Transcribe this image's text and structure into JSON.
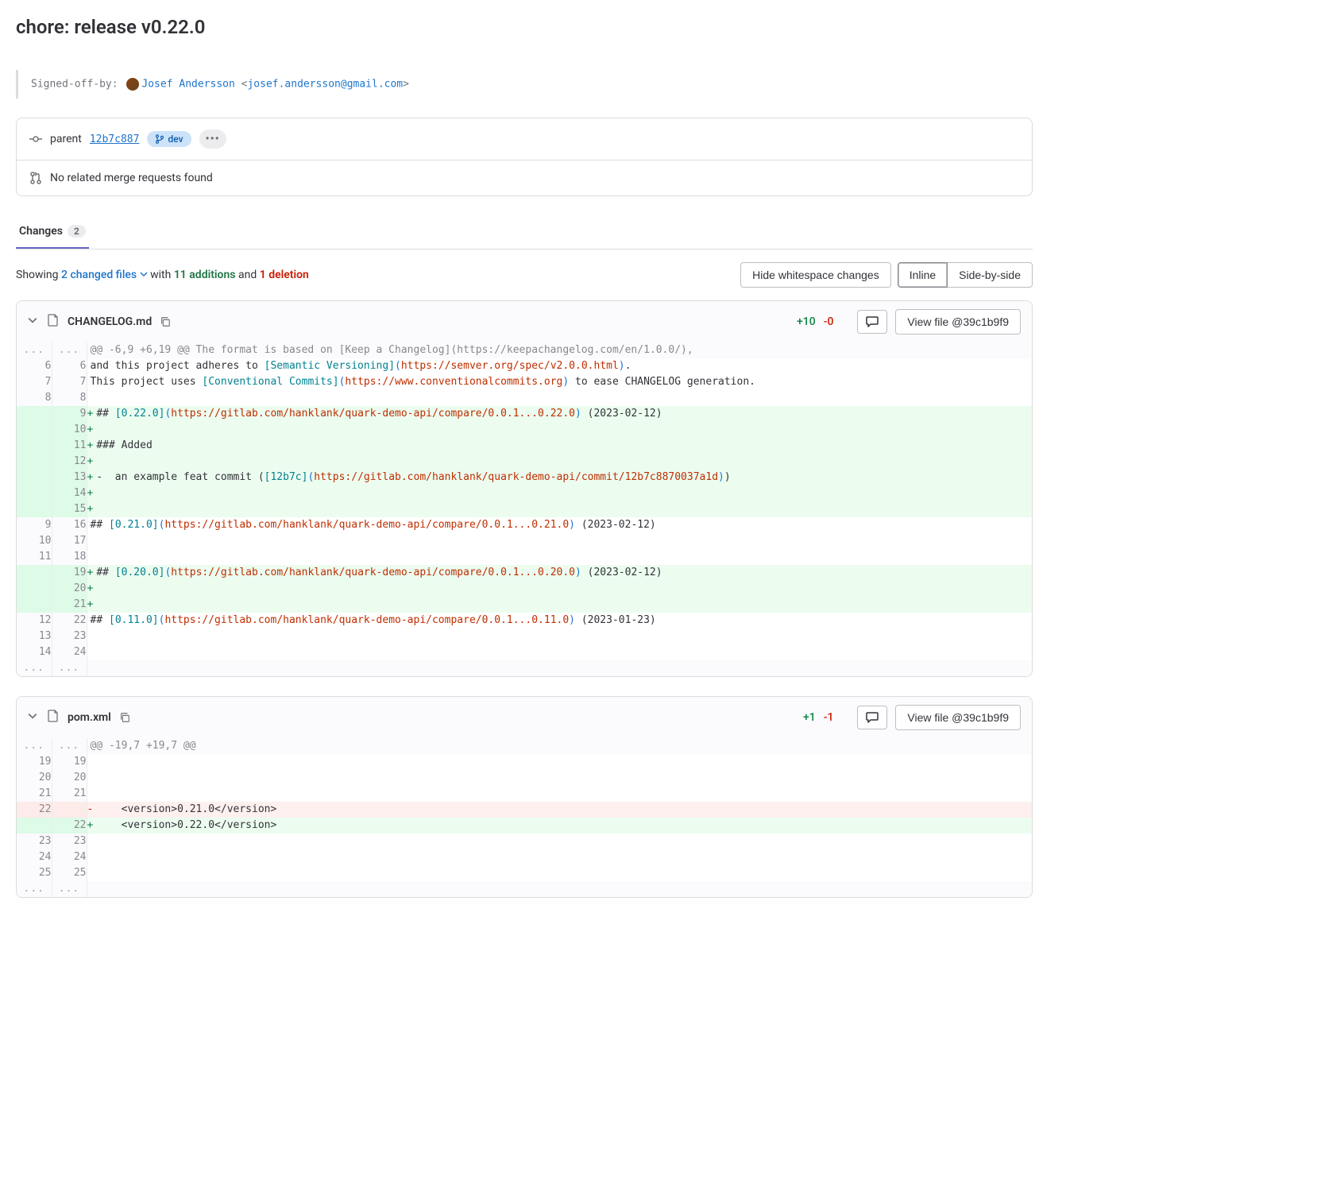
{
  "commit": {
    "title": "chore: release v0.22.0",
    "signed_off_label": "Signed-off-by:",
    "author_name": "Josef Andersson",
    "author_email": "josef.andersson@gmail.com",
    "parent_label": "parent",
    "parent_sha": "12b7c887",
    "branch_badge": "dev",
    "mr_text": "No related merge requests found"
  },
  "tabs": {
    "changes": "Changes",
    "changes_count": "2"
  },
  "summary": {
    "showing": "Showing",
    "files_text": "2 changed files",
    "with": "with",
    "additions": "11 additions",
    "and": "and",
    "deletions": "1 deletion"
  },
  "controls": {
    "hide_ws": "Hide whitespace changes",
    "inline": "Inline",
    "side": "Side-by-side"
  },
  "files": [
    {
      "name": "CHANGELOG.md",
      "stat_add": "+10",
      "stat_del": "-0",
      "view_label": "View file @39c1b9f9",
      "rows": [
        {
          "t": "hunk",
          "l": "...",
          "r": "...",
          "c": "@@ -6,9 +6,19 @@ The format is based on [Keep a Changelog](https://keepachangelog.com/en/1.0.0/),"
        },
        {
          "t": "ctx",
          "l": "6",
          "r": "6",
          "c": "and this project adheres to [Semantic Versioning](https://semver.org/spec/v2.0.0.html)."
        },
        {
          "t": "ctx",
          "l": "7",
          "r": "7",
          "c": "This project uses [Conventional Commits](https://www.conventionalcommits.org) to ease CHANGELOG generation."
        },
        {
          "t": "ctx",
          "l": "8",
          "r": "8",
          "c": ""
        },
        {
          "t": "add",
          "l": "",
          "r": "9",
          "c": "## [0.22.0](https://gitlab.com/hanklank/quark-demo-api/compare/0.0.1...0.22.0) (2023-02-12)"
        },
        {
          "t": "add",
          "l": "",
          "r": "10",
          "c": ""
        },
        {
          "t": "add",
          "l": "",
          "r": "11",
          "c": "### Added"
        },
        {
          "t": "add",
          "l": "",
          "r": "12",
          "c": ""
        },
        {
          "t": "add",
          "l": "",
          "r": "13",
          "c": "-  an example feat commit ([12b7c](https://gitlab.com/hanklank/quark-demo-api/commit/12b7c8870037a1d))"
        },
        {
          "t": "add",
          "l": "",
          "r": "14",
          "c": ""
        },
        {
          "t": "add",
          "l": "",
          "r": "15",
          "c": ""
        },
        {
          "t": "ctx",
          "l": "9",
          "r": "16",
          "c": "## [0.21.0](https://gitlab.com/hanklank/quark-demo-api/compare/0.0.1...0.21.0) (2023-02-12)"
        },
        {
          "t": "ctx",
          "l": "10",
          "r": "17",
          "c": ""
        },
        {
          "t": "ctx",
          "l": "11",
          "r": "18",
          "c": ""
        },
        {
          "t": "add",
          "l": "",
          "r": "19",
          "c": "## [0.20.0](https://gitlab.com/hanklank/quark-demo-api/compare/0.0.1...0.20.0) (2023-02-12)"
        },
        {
          "t": "add",
          "l": "",
          "r": "20",
          "c": ""
        },
        {
          "t": "add",
          "l": "",
          "r": "21",
          "c": ""
        },
        {
          "t": "ctx",
          "l": "12",
          "r": "22",
          "c": "## [0.11.0](https://gitlab.com/hanklank/quark-demo-api/compare/0.0.1...0.11.0) (2023-01-23)"
        },
        {
          "t": "ctx",
          "l": "13",
          "r": "23",
          "c": ""
        },
        {
          "t": "ctx",
          "l": "14",
          "r": "24",
          "c": ""
        },
        {
          "t": "hunk",
          "l": "...",
          "r": "...",
          "c": ""
        }
      ]
    },
    {
      "name": "pom.xml",
      "stat_add": "+1",
      "stat_del": "-1",
      "view_label": "View file @39c1b9f9",
      "rows": [
        {
          "t": "hunk",
          "l": "...",
          "r": "...",
          "c": "@@ -19,7 +19,7 @@"
        },
        {
          "t": "ctx",
          "l": "19",
          "r": "19",
          "c": ""
        },
        {
          "t": "ctx",
          "l": "20",
          "r": "20",
          "c": ""
        },
        {
          "t": "ctx",
          "l": "21",
          "r": "21",
          "c": ""
        },
        {
          "t": "del",
          "l": "22",
          "r": "",
          "c": "    <version>0.21.0</version>"
        },
        {
          "t": "add",
          "l": "",
          "r": "22",
          "c": "    <version>0.22.0</version>"
        },
        {
          "t": "ctx",
          "l": "23",
          "r": "23",
          "c": ""
        },
        {
          "t": "ctx",
          "l": "24",
          "r": "24",
          "c": ""
        },
        {
          "t": "ctx",
          "l": "25",
          "r": "25",
          "c": ""
        },
        {
          "t": "hunk",
          "l": "...",
          "r": "...",
          "c": ""
        }
      ]
    }
  ]
}
